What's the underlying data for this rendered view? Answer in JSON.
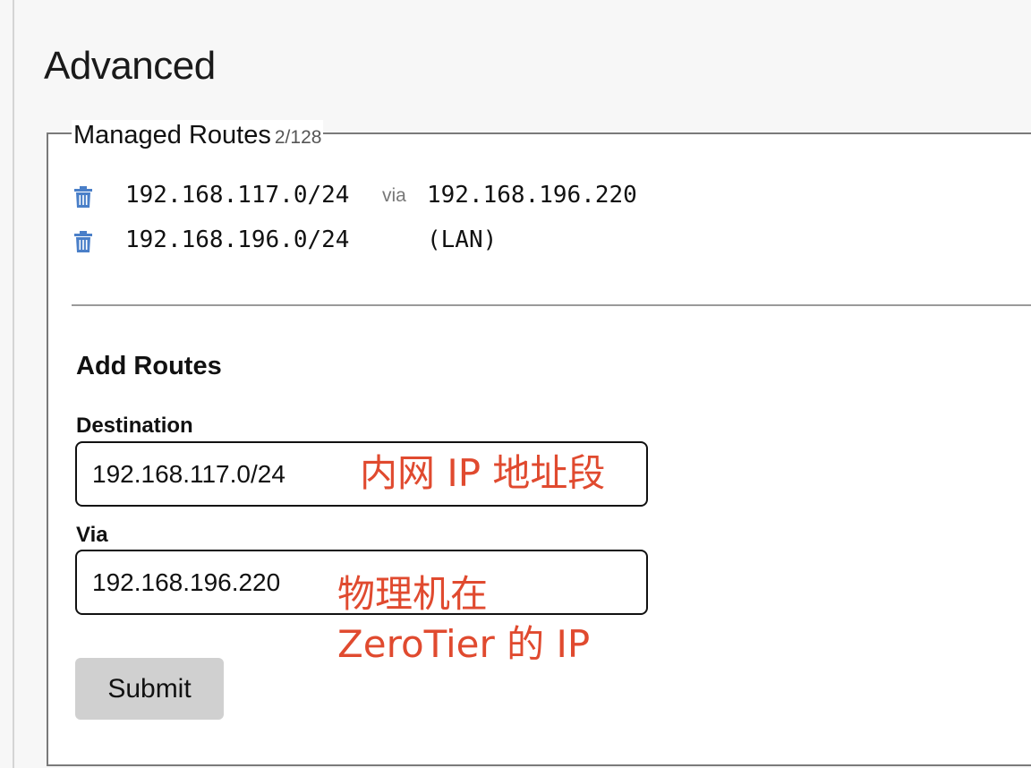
{
  "section": {
    "title": "Advanced"
  },
  "managed_routes": {
    "legend": "Managed Routes",
    "count": "2/128",
    "routes": [
      {
        "destination": "192.168.117.0/24",
        "via_label": "via",
        "target": "192.168.196.220"
      },
      {
        "destination": "192.168.196.0/24",
        "via_label": "",
        "target": "(LAN)"
      }
    ]
  },
  "add_routes": {
    "heading": "Add Routes",
    "destination_label": "Destination",
    "destination_value": "192.168.117.0/24",
    "via_label": "Via",
    "via_value": "192.168.196.220",
    "submit_label": "Submit"
  },
  "annotations": {
    "destination_note": "内网 IP 地址段",
    "via_note_line1": "物理机在",
    "via_note_line2": "ZeroTier 的 IP"
  },
  "colors": {
    "accent_icon": "#4a7fc8",
    "annotation": "#e04a2f",
    "button_bg": "#d0d0d0"
  },
  "icons": {
    "delete": "trash-icon"
  }
}
